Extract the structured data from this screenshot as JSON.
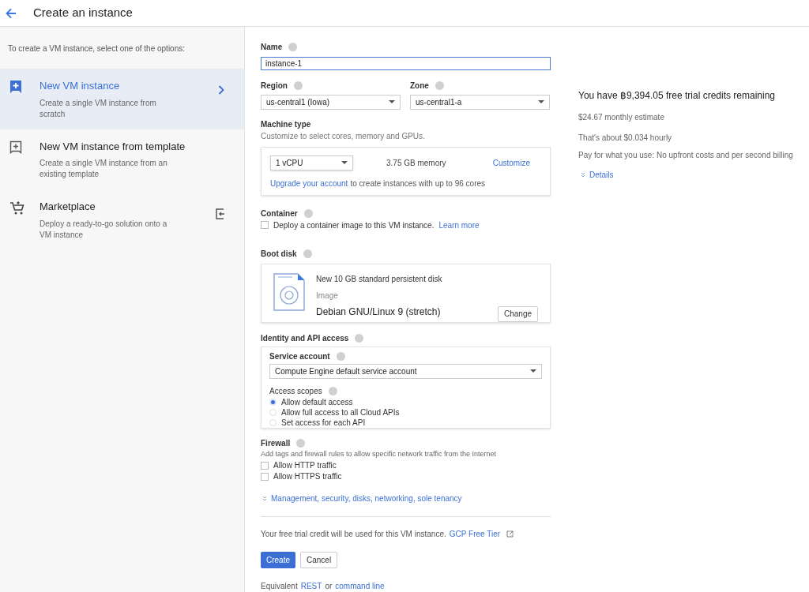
{
  "header": {
    "title": "Create an instance"
  },
  "sidebar": {
    "intro": "To create a VM instance, select one of the options:",
    "items": [
      {
        "kind": "vm",
        "title": "New VM instance",
        "description": "Create a single VM instance from scratch",
        "selected": true
      },
      {
        "kind": "template",
        "title": "New VM instance from template",
        "description": "Create a single VM instance from an existing template",
        "selected": false
      },
      {
        "kind": "marketplace",
        "title": "Marketplace",
        "description": "Deploy a ready-to-go solution onto a VM instance",
        "selected": false
      }
    ]
  },
  "form": {
    "name": {
      "label": "Name",
      "value": "instance-1"
    },
    "region": {
      "label": "Region",
      "value": "us-central1 (Iowa)"
    },
    "zone": {
      "label": "Zone",
      "value": "us-central1-a"
    },
    "machine_type": {
      "label": "Machine type",
      "hint": "Customize to select cores, memory and GPUs.",
      "cores": "1 vCPU",
      "memory": "3.75 GB memory",
      "customize": "Customize",
      "upgrade_link": "Upgrade your account",
      "upgrade_text": "to create instances with up to 96 cores"
    },
    "container": {
      "label": "Container",
      "checkbox": "Deploy a container image to this VM instance.",
      "checked": false,
      "link": "Learn more"
    },
    "boot_disk": {
      "label": "Boot disk",
      "title": "New 10 GB standard persistent disk",
      "image_label": "Image",
      "image": "Debian GNU/Linux 9 (stretch)",
      "button": "Change"
    },
    "identity": {
      "label": "Identity and API access",
      "service_label": "Service account",
      "service_value": "Compute Engine default service account",
      "scopes_label": "Access scopes",
      "scopes": [
        {
          "label": "Allow default access",
          "selected": true
        },
        {
          "label": "Allow full access to all Cloud APIs",
          "selected": false
        },
        {
          "label": "Set access for each API",
          "selected": false
        }
      ]
    },
    "firewall": {
      "label": "Firewall",
      "hint": "Add tags and firewall rules to allow specific network traffic from the Internet",
      "options": [
        {
          "label": "Allow HTTP traffic",
          "checked": false
        },
        {
          "label": "Allow HTTPS traffic",
          "checked": false
        }
      ]
    },
    "more_link": "Management, security, disks, networking, sole tenancy",
    "credit_note": "Your free trial credit will be used for this VM instance.",
    "free_tier_link": "GCP Free Tier",
    "buttons": {
      "create": "Create",
      "cancel": "Cancel"
    },
    "equivalent": {
      "text": "Equivalent",
      "rest": "REST",
      "or": "or",
      "command_line": "command line"
    }
  },
  "summary": {
    "title": "You have ฿9,394.05 free trial credits remaining",
    "monthly": "$24.67 monthly estimate",
    "hourly": "That's about $0.034 hourly",
    "billing": "Pay for what you use: No upfront costs and per second billing",
    "details": "Details"
  }
}
